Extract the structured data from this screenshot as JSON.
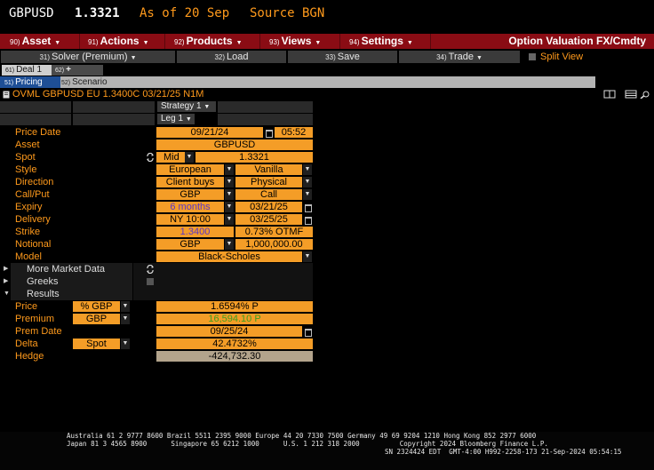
{
  "security": {
    "ticker": "GBPUSD",
    "price": "1.3321",
    "as_of": "As of 20 Sep",
    "source": "Source BGN"
  },
  "menu": {
    "items": [
      {
        "num": "90)",
        "label": "Asset"
      },
      {
        "num": "91)",
        "label": "Actions"
      },
      {
        "num": "92)",
        "label": "Products"
      },
      {
        "num": "93)",
        "label": "Views"
      },
      {
        "num": "94)",
        "label": "Settings"
      }
    ],
    "title": "Option Valuation FX/Cmdty"
  },
  "toolbar": {
    "buttons": [
      {
        "num": "31)",
        "label": "Solver (Premium)"
      },
      {
        "num": "32)",
        "label": "Load"
      },
      {
        "num": "33)",
        "label": "Save"
      },
      {
        "num": "34)",
        "label": "Trade"
      }
    ],
    "split_view": "Split View"
  },
  "deal_tabs": [
    {
      "num": "61)",
      "label": "Deal 1"
    },
    {
      "num": "62)",
      "label": "+"
    }
  ],
  "pricing_tabs": [
    {
      "num": "51)",
      "label": "Pricing"
    },
    {
      "num": "52)",
      "label": "Scenario"
    }
  ],
  "description": "OVML GBPUSD EU 1.3400C 03/21/25 N1M",
  "strategy": "Strategy 1",
  "leg": "Leg 1",
  "fields": {
    "price_date": {
      "label": "Price Date",
      "date": "09/21/24",
      "time": "05:52"
    },
    "asset": {
      "label": "Asset",
      "value": "GBPUSD"
    },
    "spot": {
      "label": "Spot",
      "side": "Mid",
      "value": "1.3321"
    },
    "style": {
      "label": "Style",
      "value": "European",
      "value2": "Vanilla"
    },
    "direction": {
      "label": "Direction",
      "value": "Client buys",
      "value2": "Physical"
    },
    "call_put": {
      "label": "Call/Put",
      "value": "GBP",
      "value2": "Call"
    },
    "expiry": {
      "label": "Expiry",
      "value": "6 months",
      "value2": "03/21/25"
    },
    "delivery": {
      "label": "Delivery",
      "value": "NY 10:00",
      "value2": "03/25/25"
    },
    "strike": {
      "label": "Strike",
      "value": "1.3400",
      "value2": "0.73% OTMF"
    },
    "notional": {
      "label": "Notional",
      "value": "GBP",
      "value2": "1,000,000.00"
    },
    "model": {
      "label": "Model",
      "value": "Black-Scholes"
    }
  },
  "sections": [
    "More Market Data",
    "Greeks",
    "Results"
  ],
  "results": {
    "price": {
      "label": "Price",
      "unit": "% GBP",
      "value": "1.6594% P"
    },
    "premium": {
      "label": "Premium",
      "unit": "GBP",
      "value": "16,594.10 P"
    },
    "prem_date": {
      "label": "Prem Date",
      "value": "09/25/24"
    },
    "delta": {
      "label": "Delta",
      "unit": "Spot",
      "value": "42.4732%"
    },
    "hedge": {
      "label": "Hedge",
      "value": "-424,732.30"
    }
  },
  "footer": {
    "line1": "Australia 61 2 9777 8600 Brazil 5511 2395 9000 Europe 44 20 7330 7500 Germany 49 69 9204 1210 Hong Kong 852 2977 6000",
    "line2": "Japan 81 3 4565 8900      Singapore 65 6212 1000      U.S. 1 212 318 2000          Copyright 2024 Bloomberg Finance L.P.",
    "line3": "SN 2324424 EDT  GMT-4:00 H992-2258-173 21-Sep-2024 05:54:15"
  },
  "colors": {
    "accent": "#ff9a1c",
    "menu_bar": "#8a0c14",
    "field": "#f49d27",
    "active_tab": "#1e4f96"
  }
}
